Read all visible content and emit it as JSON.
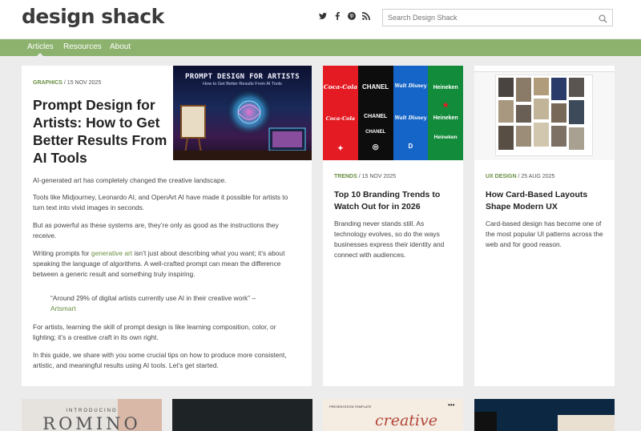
{
  "header": {
    "logo": "design shack",
    "search_placeholder": "Search Design Shack",
    "social": [
      "twitter-icon",
      "facebook-icon",
      "pinterest-icon",
      "rss-icon"
    ]
  },
  "nav": {
    "items": [
      "Articles",
      "Resources",
      "About"
    ],
    "active": "Articles"
  },
  "featured": {
    "category": "GRAPHICS",
    "date": "/ 15 NOV 2025",
    "title": "Prompt Design for Artists: How to Get Better Results From AI Tools",
    "image_title": "PROMPT DESIGN FOR ARTISTS",
    "image_subtitle": "How to Get Better Results From AI Tools",
    "p1": "AI-generated art has completely changed the creative landscape.",
    "p2": "Tools like Midjourney, Leonardo AI, and OpenArt AI have made it possible for artists to turn text into vivid images in seconds.",
    "p3": "But as powerful as these systems are, they’re only as good as the instructions they receive.",
    "p4_before": "Writing prompts for ",
    "p4_link": "generative art",
    "p4_after": " isn’t just about describing what you want; it’s about speaking the language of algorithms. A well-crafted prompt can mean the difference between a generic result and something truly inspiring.",
    "quote": "“Around 29% of digital artists currently use AI in their creative work” –",
    "quote_source": "Artsmart",
    "p5": "For artists, learning the skill of prompt design is like learning composition, color, or lighting; it’s a creative craft in its own right.",
    "p6": "In this guide, we share with you some crucial tips on how to produce more consistent, artistic, and meaningful results using AI tools. Let’s get started."
  },
  "cards": [
    {
      "category": "TRENDS",
      "date": "/ 15 NOV 2025",
      "title": "Top 10 Branding Trends to Watch Out for in 2026",
      "text": "Branding never stands still. As technology evolves, so do the ways businesses express their identity and connect with audiences.",
      "brands": [
        "Coca-Cola",
        "CHANEL",
        "Walt Disney",
        "Heineken"
      ]
    },
    {
      "category": "UX DESIGN",
      "date": "/ 25 AUG 2025",
      "title": "How Card-Based Layouts Shape Modern UX",
      "text": "Card-based design has become one of the most popular UI patterns across the web and for good reason."
    }
  ],
  "bottom": {
    "card1_small": "INTRODUCING",
    "card1_big": "ROMINO",
    "card3_small": "PRESENTATION TEMPLATE",
    "card3_dots": "•••",
    "card3_script": "creative"
  },
  "colors": {
    "accent": "#8db26e",
    "category": "#6a8f43"
  }
}
